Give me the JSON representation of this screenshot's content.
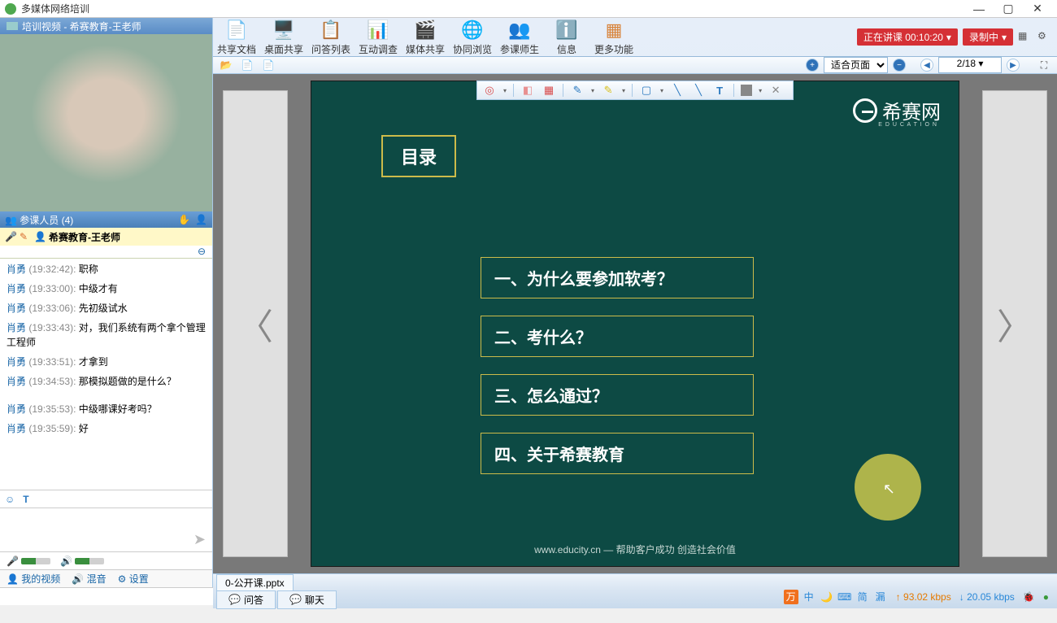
{
  "app": {
    "title": "多媒体网络培训"
  },
  "video": {
    "title": "培训视频 - 希赛教育-王老师"
  },
  "participants": {
    "label": "参课人员 (4)"
  },
  "highlight_user": "希赛教育-王老师",
  "chat": [
    {
      "name": "肖勇",
      "time": "(19:32:42):",
      "text": "职称"
    },
    {
      "name": "肖勇",
      "time": "(19:33:00):",
      "text": "中级才有"
    },
    {
      "name": "肖勇",
      "time": "(19:33:06):",
      "text": "先初级试水"
    },
    {
      "name": "肖勇",
      "time": "(19:33:43):",
      "text": "对，我们系统有两个拿个管理工程师"
    },
    {
      "name": "肖勇",
      "time": "(19:33:51):",
      "text": "才拿到"
    },
    {
      "name": "肖勇",
      "time": "(19:34:53):",
      "text": "那模拟题做的是什么？"
    },
    {
      "name": "肖勇",
      "time": "(19:35:53):",
      "text": "中级哪课好考吗？"
    },
    {
      "name": "肖勇",
      "time": "(19:35:59):",
      "text": "好"
    }
  ],
  "bottom_controls": {
    "my_video": "我的视频",
    "mix": "混音",
    "settings": "设置"
  },
  "toolbar": [
    {
      "label": "共享文档",
      "color": "#3a8dce"
    },
    {
      "label": "桌面共享",
      "color": "#2c7ac0"
    },
    {
      "label": "问答列表",
      "color": "#3a8dce"
    },
    {
      "label": "互动调查",
      "color": "#d84c4c"
    },
    {
      "label": "媒体共享",
      "color": "#3a8dce"
    },
    {
      "label": "协同浏览",
      "color": "#e8b020"
    },
    {
      "label": "参课师生",
      "color": "#6aa0d8"
    },
    {
      "label": "信息",
      "color": "#3a8dce"
    },
    {
      "label": "更多功能",
      "color": "#d8843c"
    }
  ],
  "status": {
    "lecture": "正在讲课 00:10:20",
    "record": "录制中"
  },
  "docbar": {
    "fit": "适合页面",
    "page": "2/18"
  },
  "slide": {
    "brand": "希赛网",
    "heading": "目录",
    "items": [
      "一、为什么要参加软考？",
      "二、考什么？",
      "三、怎么通过？",
      "四、关于希赛教育"
    ],
    "footer": "www.educity.cn — 帮助客户成功 创造社会价值"
  },
  "file_tab": "0-公开课.pptx",
  "chat_tabs": {
    "qa": "问答",
    "chat": "聊天"
  },
  "statusbar": {
    "ime": [
      "中",
      "简",
      "漏"
    ],
    "up": "93.02 kbps",
    "down": "20.05 kbps"
  }
}
